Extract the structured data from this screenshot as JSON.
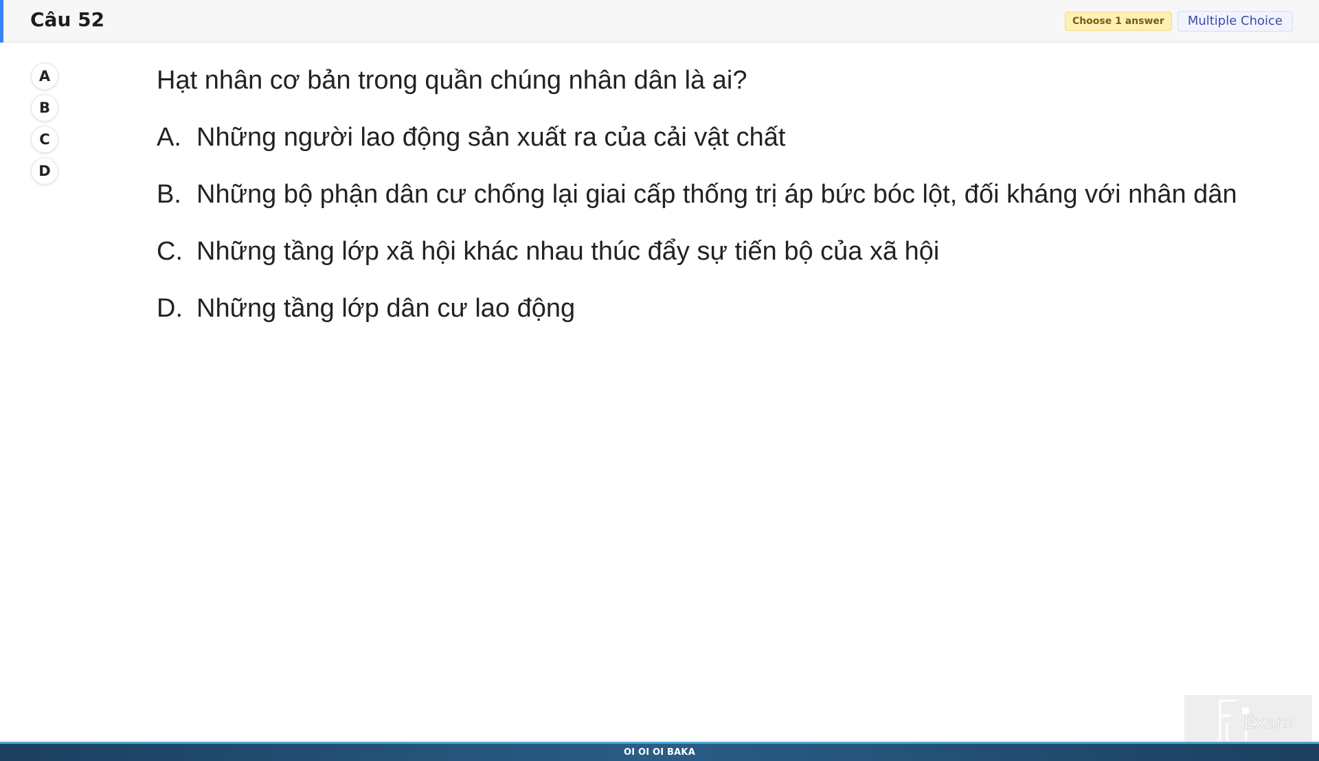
{
  "header": {
    "title": "Câu 52",
    "badge_choose": "Choose 1 answer",
    "badge_type": "Multiple Choice",
    "accent_color": "#3b82f6"
  },
  "answer_options": [
    "A",
    "B",
    "C",
    "D"
  ],
  "question": {
    "text": "Hạt nhân cơ bản trong quần chúng nhân dân là ai?",
    "choices": [
      {
        "letter": "A.",
        "text": "Những người lao động sản xuất ra của cải vật chất"
      },
      {
        "letter": "B.",
        "text": "Những bộ phận dân cư chống lại giai cấp thống trị áp bức bóc lột, đối kháng với nhân dân"
      },
      {
        "letter": "C.",
        "text": "Những tầng lớp xã hội khác nhau thúc đẩy sự tiến bộ của xã hội"
      },
      {
        "letter": "D.",
        "text": "Những tầng lớp dân cư lao động"
      }
    ]
  },
  "watermark": {
    "text": "Exam",
    "icon": "fu-exam-logo-icon"
  },
  "footer": {
    "text": "OI OI OI BAKA"
  }
}
